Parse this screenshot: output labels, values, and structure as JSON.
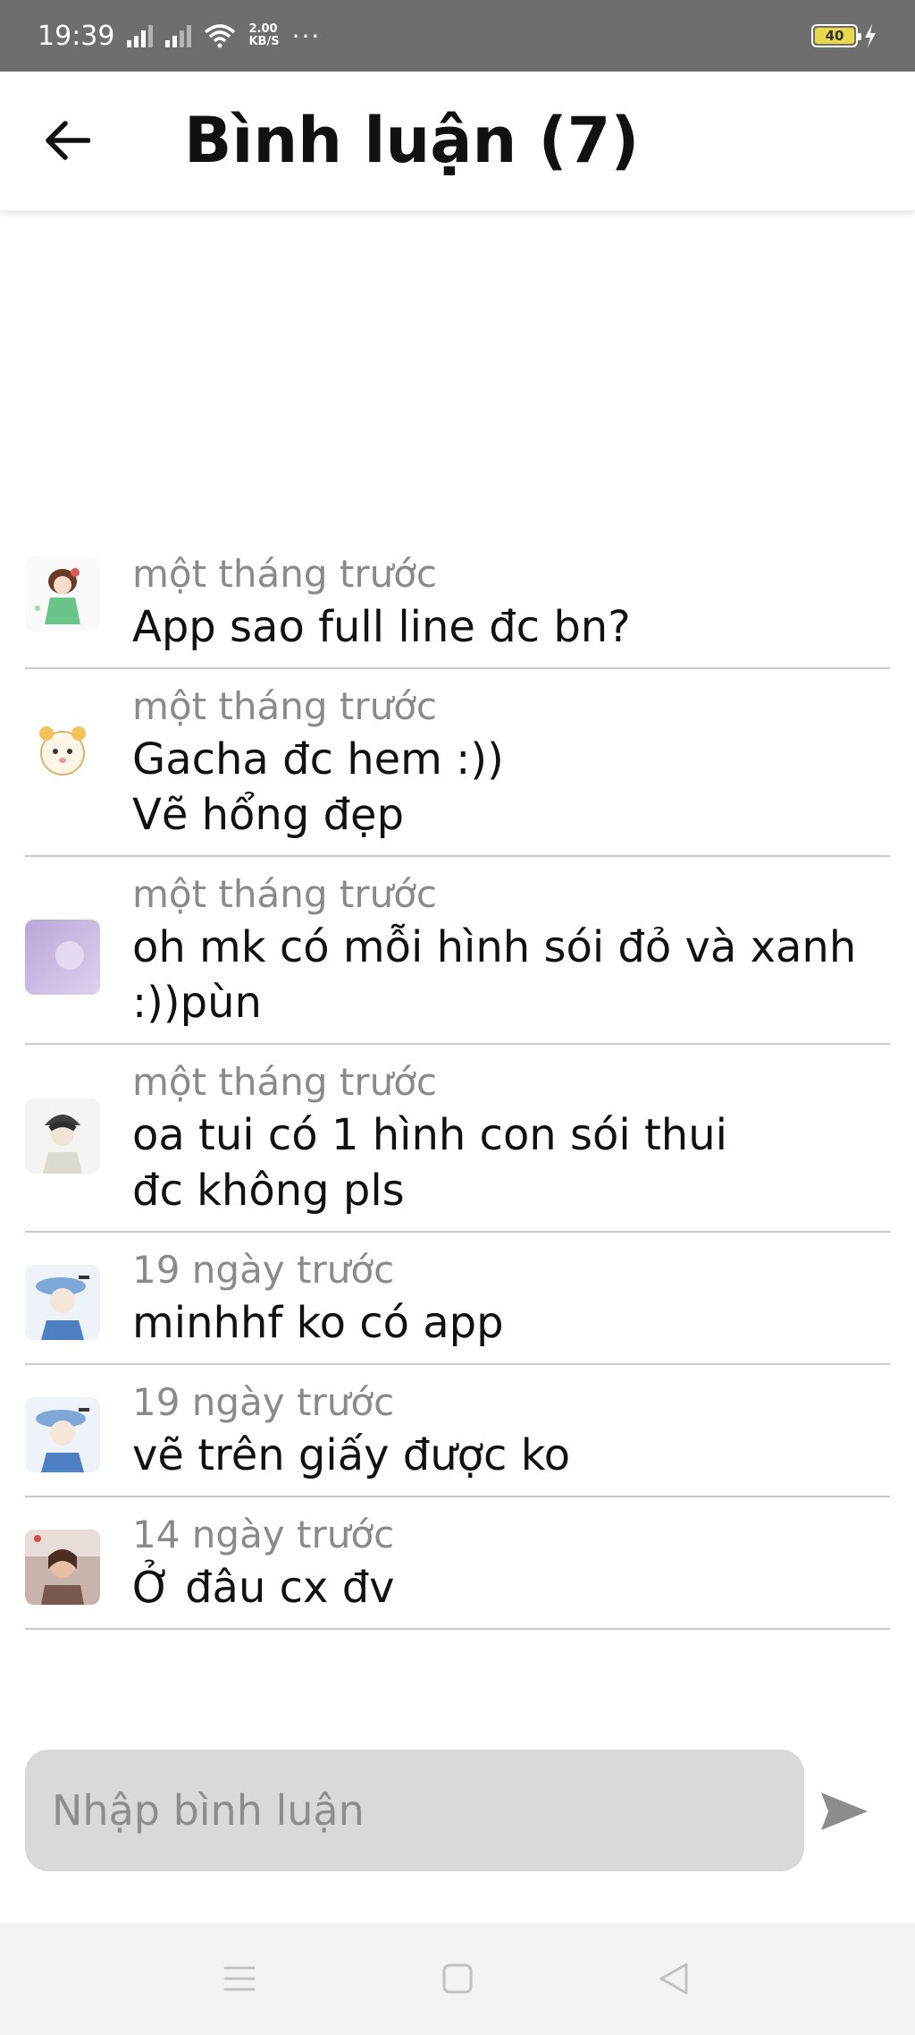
{
  "status_bar": {
    "time": "19:39",
    "speed_value": "2.00",
    "speed_unit": "KB/S",
    "more": "···",
    "battery": "40"
  },
  "header": {
    "title": "Bình luận (7)"
  },
  "comments": [
    {
      "time": "một tháng trước",
      "text": "App sao full line đc bn?",
      "avatar": "anime-girl-green-dress-avatar"
    },
    {
      "time": "một tháng trước",
      "text": "Gacha đc hem :))\nVẽ hổng đẹp",
      "avatar": "cute-bear-avatar"
    },
    {
      "time": "một tháng trước",
      "text": "oh mk có mỗi hình sói đỏ và xanh\n:))pùn",
      "avatar": "purple-blur-avatar"
    },
    {
      "time": "một tháng trước",
      "text": "oa tui có 1 hình con sói thui\nđc không pls",
      "avatar": "anime-boy-hat-avatar"
    },
    {
      "time": "19 ngày trước",
      "text": "minhhf ko có app",
      "avatar": "anime-blue-hat-avatar"
    },
    {
      "time": "19 ngày trước",
      "text": "vẽ trên giấy được ko",
      "avatar": "anime-blue-hat-avatar"
    },
    {
      "time": "14 ngày trước",
      "text": "Ở đâu cx đv",
      "avatar": "photo-person-avatar"
    }
  ],
  "input": {
    "placeholder": "Nhập bình luận"
  },
  "icons": {
    "back": "arrow-left-icon",
    "send": "send-icon",
    "menu": "menu-icon",
    "home": "home-icon",
    "nav_back": "nav-back-icon"
  },
  "colors": {
    "status_bar_bg": "#6e6e6e",
    "input_bg": "#d9d9d9",
    "send_icon": "#8c8c8c",
    "divider": "#c9c9c9"
  }
}
